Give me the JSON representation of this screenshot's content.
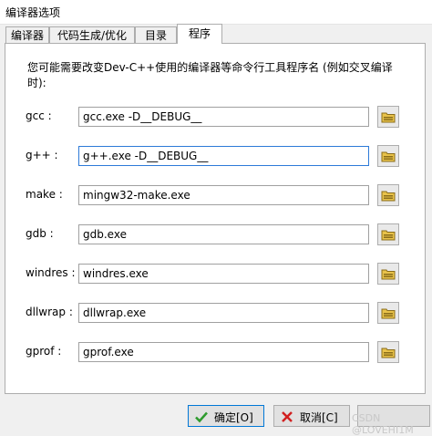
{
  "window": {
    "title": "编译器选项"
  },
  "tabs": [
    {
      "label": "编译器",
      "active": false
    },
    {
      "label": "代码生成/优化",
      "active": false
    },
    {
      "label": "目录",
      "active": false
    },
    {
      "label": "程序",
      "active": true
    }
  ],
  "programs": {
    "description": "您可能需要改变Dev-C++使用的编译器等命令行工具程序名 (例如交叉编译时):",
    "rows": [
      {
        "label": "gcc :",
        "value": "gcc.exe -D__DEBUG__"
      },
      {
        "label": "g++ :",
        "value": "g++.exe -D__DEBUG__"
      },
      {
        "label": "make :",
        "value": "mingw32-make.exe"
      },
      {
        "label": "gdb :",
        "value": "gdb.exe"
      },
      {
        "label": "windres :",
        "value": "windres.exe"
      },
      {
        "label": "dllwrap :",
        "value": "dllwrap.exe"
      },
      {
        "label": "gprof :",
        "value": "gprof.exe"
      }
    ]
  },
  "buttons": {
    "ok": "确定[O]",
    "cancel": "取消[C]",
    "help": ""
  },
  "watermark": "CSDN @LOVEHI1M",
  "colors": {
    "focus_border": "#2d7ad8",
    "ok_icon": "#2e9b2e",
    "cancel_icon": "#d12020"
  }
}
